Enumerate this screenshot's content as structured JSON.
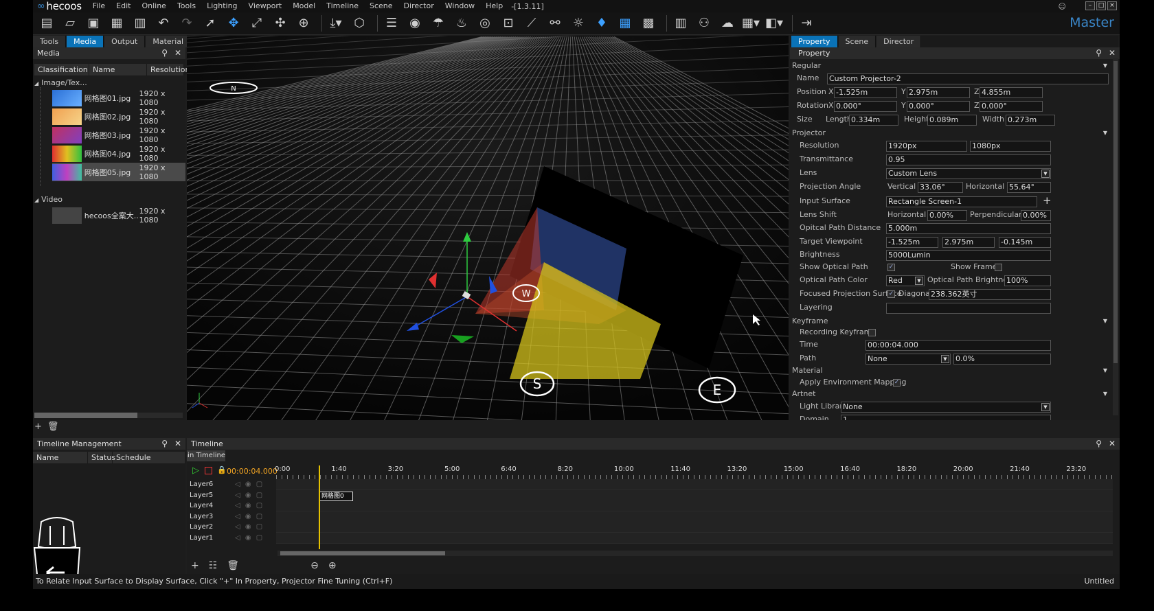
{
  "app": {
    "logo": "hecoos",
    "version": "-[1.3.11]",
    "mode": "Master",
    "status": "To Relate Input Surface to Display Surface, Click \"+\" In Property, Projector Fine Tuning (Ctrl+F)",
    "doc": "Untitled"
  },
  "menu": [
    "File",
    "Edit",
    "Online",
    "Tools",
    "Lighting",
    "Viewport",
    "Model",
    "Timeline",
    "Scene",
    "Director",
    "Window",
    "Help"
  ],
  "left_tabs": [
    "Tools",
    "Media",
    "Output",
    "Material"
  ],
  "media": {
    "title": "Media",
    "columns": [
      "Classification",
      "Name",
      "Resolution"
    ],
    "groups": [
      "Image/Tex...",
      "Video"
    ],
    "images": [
      {
        "name": "网格图01.jpg",
        "res": "1920 x 1080"
      },
      {
        "name": "网格图02.jpg",
        "res": "1920 x 1080"
      },
      {
        "name": "网格图03.jpg",
        "res": "1920 x 1080"
      },
      {
        "name": "网格图04.jpg",
        "res": "1920 x 1080"
      },
      {
        "name": "网格图05.jpg",
        "res": "1920 x 1080"
      }
    ],
    "videos": [
      {
        "name": "hecoos全案大...",
        "res": "1920 x 1080"
      }
    ]
  },
  "viewport": {
    "markers": [
      "N",
      "W",
      "S",
      "E"
    ]
  },
  "right_tabs": [
    "Property",
    "Scene",
    "Director"
  ],
  "property": {
    "title": "Property",
    "sections": {
      "regular": "Regular",
      "projector": "Projector",
      "keyframe": "Keyframe",
      "material": "Material",
      "artnet": "Artnet"
    },
    "name_label": "Name",
    "name": "Custom Projector-2",
    "position_label": "Position",
    "pos": [
      "-1.525m",
      "2.975m",
      "4.855m"
    ],
    "rotation_label": "Rotation",
    "rot": [
      "0.000°",
      "0.000°",
      "0.000°"
    ],
    "axes": [
      "X",
      "Y",
      "Z"
    ],
    "size_label": "Size",
    "length_label": "Length",
    "length": "0.334m",
    "height_label": "Height",
    "height": "0.089m",
    "width_label": "Width",
    "width": "0.273m",
    "resolution_label": "Resolution",
    "res_w": "1920px",
    "res_h": "1080px",
    "transmittance_label": "Transmittance",
    "transmittance": "0.95",
    "lens_label": "Lens",
    "lens": "Custom Lens",
    "proj_angle_label": "Projection Angle",
    "vertical_label": "Vertical",
    "vertical": "33.06°",
    "horizontal_label": "Horizontal",
    "horizontal": "55.64°",
    "input_surface_label": "Input Surface",
    "input_surface": "Rectangle Screen-1",
    "lens_shift_label": "Lens Shift",
    "ls_h_label": "Horizontal",
    "ls_h": "0.00%",
    "ls_p_label": "Perpendicular",
    "ls_p": "0.00%",
    "optical_dist_label": "Opitcal Path Distance",
    "optical_dist": "5.000m",
    "target_label": "Target Viewpoint",
    "target": [
      "-1.525m",
      "2.975m",
      "-0.145m"
    ],
    "brightness_label": "Brightness",
    "brightness": "5000Lumin",
    "show_path_label": "Show Optical Path",
    "show_frame_label": "Show Frame",
    "path_color_label": "Optical Path Color",
    "path_color": "Red",
    "path_bright_label": "Optical Path Brightness",
    "path_bright": "100%",
    "focused_label": "Focused Projection Surface",
    "diagonal_label": "Diagonal",
    "diagonal": "238.362英寸",
    "layering_label": "Layering",
    "rec_kf_label": "Recording Keyframe",
    "time_label": "Time",
    "time": "00:00:04.000",
    "path_label": "Path",
    "path": "None",
    "path_pct": "0.0%",
    "env_map_label": "Apply Environment Mapping",
    "light_lib_label": "Light Library",
    "light_lib": "None",
    "domain_label": "Domain",
    "domain": "1"
  },
  "timeline_mgmt": {
    "title": "Timeline Management",
    "columns": [
      "Name",
      "Status",
      "Schedule"
    ]
  },
  "timeline": {
    "title": "Timeline",
    "tab": "Main Timeline",
    "current": "00:00:04.000",
    "ticks": [
      "0:00",
      "1:40",
      "3:20",
      "5:00",
      "6:40",
      "8:20",
      "10:00",
      "11:40",
      "13:20",
      "15:00",
      "16:40",
      "18:20",
      "20:00",
      "21:40",
      "23:20"
    ],
    "layers": [
      "Layer6",
      "Layer5",
      "Layer4",
      "Layer3",
      "Layer2",
      "Layer1"
    ],
    "clip": "网格图0"
  }
}
